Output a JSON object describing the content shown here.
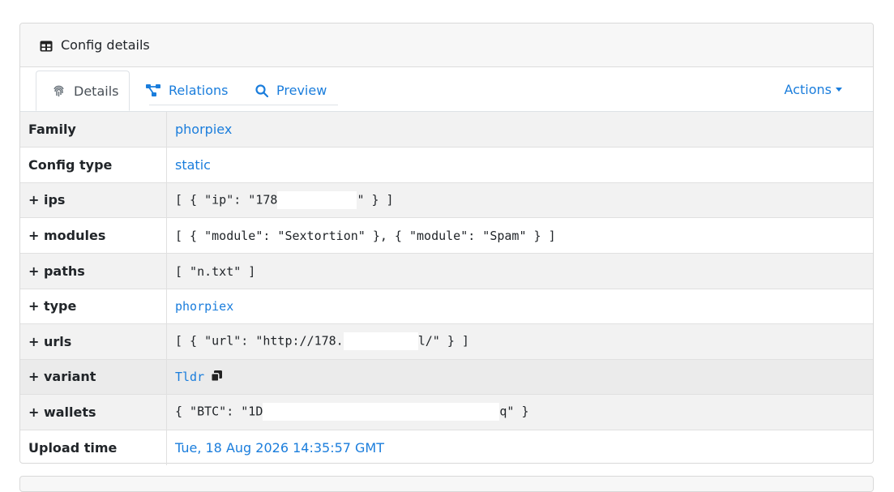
{
  "card": {
    "title": "Config details"
  },
  "tabs": [
    {
      "label": "Details",
      "icon": "fingerprint-icon",
      "active": true
    },
    {
      "label": "Relations",
      "icon": "share-nodes-icon",
      "active": false
    },
    {
      "label": "Preview",
      "icon": "search-icon",
      "active": false
    }
  ],
  "actions": {
    "label": "Actions"
  },
  "rows": {
    "family": {
      "key": "Family",
      "value": "phorpiex"
    },
    "config_type": {
      "key": "Config type",
      "value": "static"
    },
    "ips": {
      "key": "+ ips",
      "prefix": "[ { \"ip\": \"178",
      "suffix": "\" } ]"
    },
    "modules": {
      "key": "+ modules",
      "value": "[ { \"module\": \"Sextortion\" }, { \"module\": \"Spam\" } ]"
    },
    "paths": {
      "key": "+ paths",
      "value": "[ \"n.txt\" ]"
    },
    "type": {
      "key": "+ type",
      "value": "phorpiex"
    },
    "urls": {
      "key": "+ urls",
      "prefix": "[ { \"url\": \"http://178.",
      "suffix": "l/\" } ]"
    },
    "variant": {
      "key": "+ variant",
      "value": "Tldr"
    },
    "wallets": {
      "key": "+ wallets",
      "prefix": "{ \"BTC\": \"1D",
      "suffix": "q\" }"
    },
    "upload_time": {
      "key": "Upload time",
      "value": "Tue, 18 Aug 2026 14:35:57 GMT"
    }
  },
  "colors": {
    "link": "#1a7ddc",
    "row_alt": "#f2f2f2",
    "header_bg": "#f7f7f7"
  }
}
